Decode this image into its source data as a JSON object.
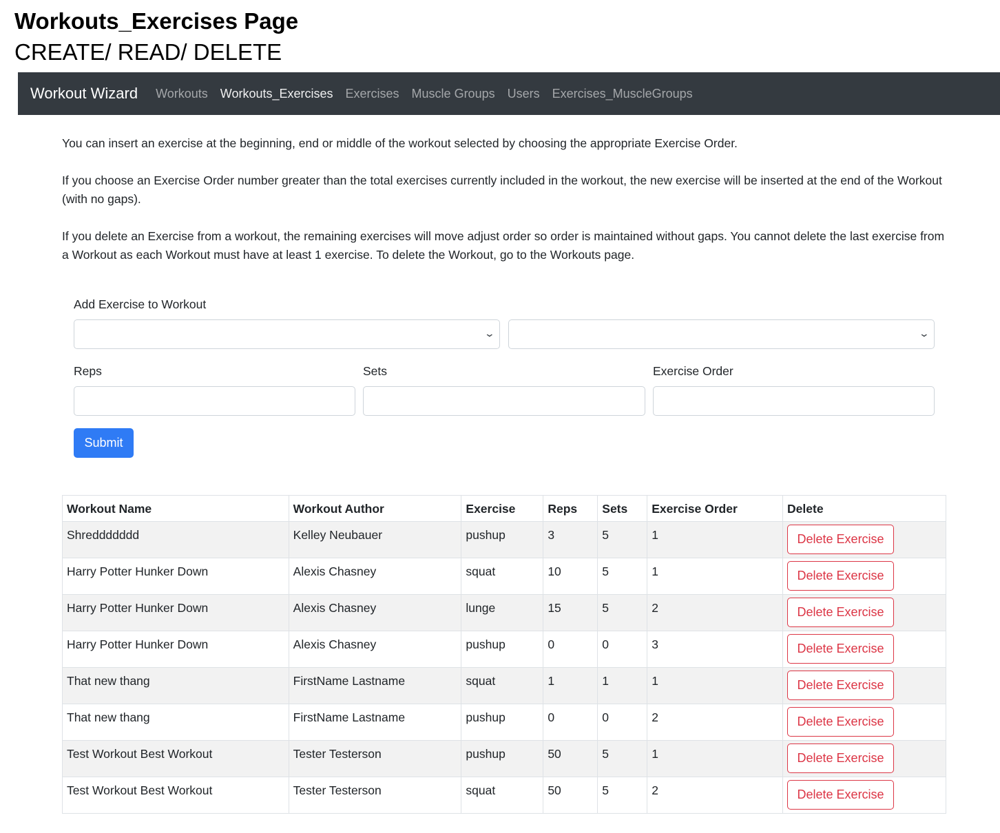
{
  "header": {
    "title": "Workouts_Exercises Page",
    "subtitle": "CREATE/ READ/ DELETE"
  },
  "navbar": {
    "brand": "Workout Wizard",
    "links": [
      {
        "label": "Workouts",
        "active": false
      },
      {
        "label": "Workouts_Exercises",
        "active": true
      },
      {
        "label": "Exercises",
        "active": false
      },
      {
        "label": "Muscle Groups",
        "active": false
      },
      {
        "label": "Users",
        "active": false
      },
      {
        "label": "Exercises_MuscleGroups",
        "active": false
      }
    ]
  },
  "intro": [
    "You can insert an exercise at the beginning, end or middle of the workout selected by choosing the appropriate Exercise Order.",
    "If you choose an Exercise Order number greater than the total exercises currently included in the workout, the new exercise will be inserted at the end of the Workout (with no gaps).",
    "If you delete an Exercise from a workout, the remaining exercises will move adjust order so order is maintained without gaps. You cannot delete the last exercise from a Workout as each Workout must have at least 1 exercise. To delete the Workout, go to the Workouts page."
  ],
  "form": {
    "heading": "Add Exercise to Workout",
    "workout_select_value": "",
    "exercise_select_value": "",
    "reps_label": "Reps",
    "sets_label": "Sets",
    "order_label": "Exercise Order",
    "reps_value": "",
    "sets_value": "",
    "order_value": "",
    "submit_label": "Submit"
  },
  "table": {
    "headers": [
      "Workout Name",
      "Workout Author",
      "Exercise",
      "Reps",
      "Sets",
      "Exercise Order",
      "Delete"
    ],
    "delete_label": "Delete Exercise",
    "rows": [
      [
        "Shreddddddd",
        "Kelley Neubauer",
        "pushup",
        "3",
        "5",
        "1"
      ],
      [
        "Harry Potter Hunker Down",
        "Alexis Chasney",
        "squat",
        "10",
        "5",
        "1"
      ],
      [
        "Harry Potter Hunker Down",
        "Alexis Chasney",
        "lunge",
        "15",
        "5",
        "2"
      ],
      [
        "Harry Potter Hunker Down",
        "Alexis Chasney",
        "pushup",
        "0",
        "0",
        "3"
      ],
      [
        "That new thang",
        "FirstName Lastname",
        "squat",
        "1",
        "1",
        "1"
      ],
      [
        "That new thang",
        "FirstName Lastname",
        "pushup",
        "0",
        "0",
        "2"
      ],
      [
        "Test Workout Best Workout",
        "Tester Testerson",
        "pushup",
        "50",
        "5",
        "1"
      ],
      [
        "Test Workout Best Workout",
        "Tester Testerson",
        "squat",
        "50",
        "5",
        "2"
      ]
    ]
  },
  "colors": {
    "navbar_bg": "#343a40",
    "primary": "#2f7bf5",
    "danger": "#dc3545",
    "stripe": "#f2f2f2"
  },
  "icons": {
    "select_arrow": "chevron-down-icon"
  }
}
